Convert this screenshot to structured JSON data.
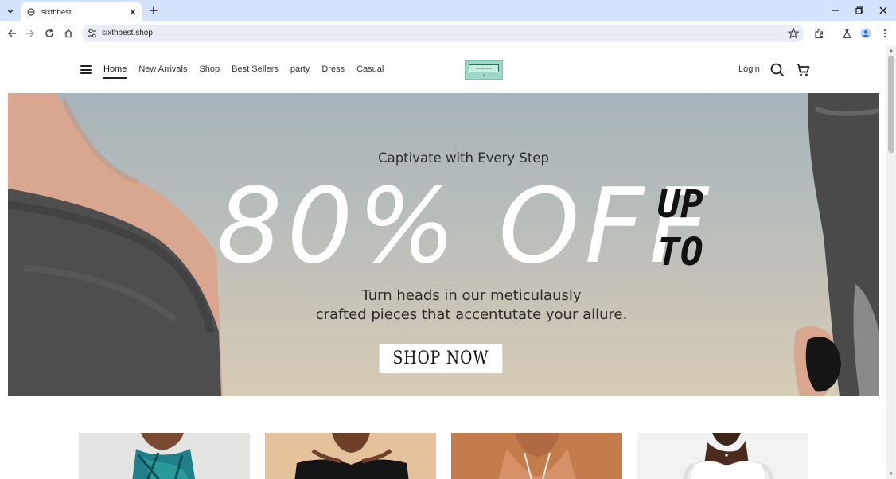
{
  "browser": {
    "tab_title": "sixthbest",
    "url": "sixthbest.shop"
  },
  "nav": {
    "items": [
      "Home",
      "New Arrivals",
      "Shop",
      "Best Sellers",
      "party",
      "Dress",
      "Casual"
    ],
    "active": "Home",
    "login_label": "Login"
  },
  "logo": {
    "text": "sixthbest.shop"
  },
  "hero": {
    "tagline": "Captivate with Every Step",
    "discount": "80% OFF",
    "upto_line1": "UP",
    "upto_line2": "TO",
    "subtitle_line1": "Turn heads in our meticulausly",
    "subtitle_line2": "crafted pieces that accentutate your allure.",
    "cta_label": "SHOP NOW"
  },
  "colors": {
    "chrome_tab_strip": "#d3e3fd",
    "omnibox": "#e9eef6",
    "logo_bg": "#9ed9c7"
  },
  "products": [
    {
      "icon": "product-image-teal-dress"
    },
    {
      "icon": "product-image-black-dress"
    },
    {
      "icon": "product-image-halter-dress"
    },
    {
      "icon": "product-image-white-dress"
    }
  ]
}
